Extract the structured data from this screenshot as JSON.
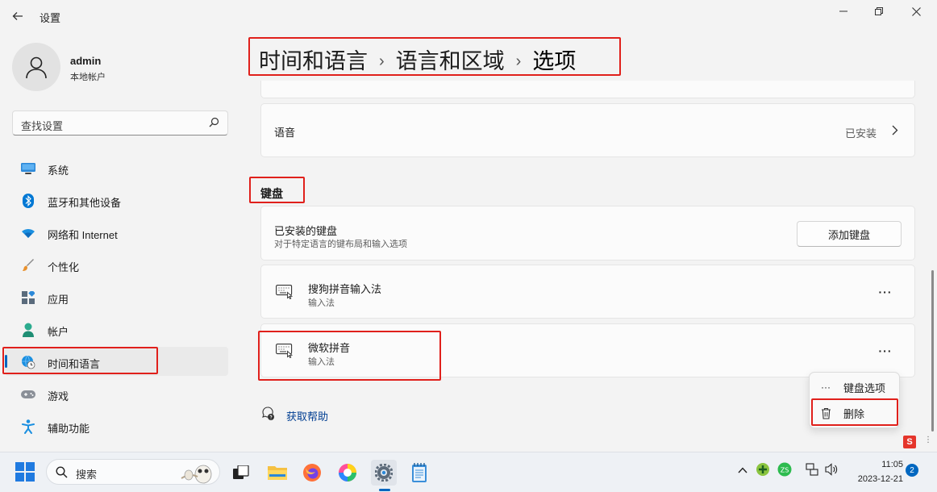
{
  "window": {
    "title": "设置",
    "controls": [
      "minimize",
      "maximize",
      "close"
    ]
  },
  "user": {
    "name": "admin",
    "account_type": "本地帐户"
  },
  "search": {
    "placeholder": "查找设置"
  },
  "sidebar": {
    "items": [
      {
        "label": "系统",
        "icon": "monitor-icon",
        "active": false
      },
      {
        "label": "蓝牙和其他设备",
        "icon": "bluetooth-icon",
        "active": false
      },
      {
        "label": "网络和 Internet",
        "icon": "wifi-icon",
        "active": false
      },
      {
        "label": "个性化",
        "icon": "brush-icon",
        "active": false
      },
      {
        "label": "应用",
        "icon": "apps-icon",
        "active": false
      },
      {
        "label": "帐户",
        "icon": "person-icon",
        "active": false
      },
      {
        "label": "时间和语言",
        "icon": "globe-clock-icon",
        "active": true
      },
      {
        "label": "游戏",
        "icon": "gamepad-icon",
        "active": false
      },
      {
        "label": "辅助功能",
        "icon": "accessibility-icon",
        "active": false
      }
    ]
  },
  "breadcrumb": {
    "items": [
      "时间和语言",
      "语言和区域",
      "选项"
    ],
    "separator": "›"
  },
  "speech": {
    "label": "语音",
    "status": "已安装"
  },
  "keyboard_section": {
    "heading": "键盘",
    "installed_title": "已安装的键盘",
    "installed_desc": "对于特定语言的键布局和输入选项",
    "add_button": "添加键盘",
    "keyboards": [
      {
        "name": "搜狗拼音输入法",
        "type": "输入法"
      },
      {
        "name": "微软拼音",
        "type": "输入法"
      }
    ]
  },
  "help": {
    "label": "获取帮助"
  },
  "context_menu": {
    "items": [
      {
        "label": "键盘选项",
        "icon": "more-icon"
      },
      {
        "label": "删除",
        "icon": "trash-icon"
      }
    ]
  },
  "taskbar": {
    "search_placeholder": "搜索",
    "time": "11:05",
    "date": "2023-12-21",
    "notification_count": "2",
    "ime_label": "S"
  },
  "colors": {
    "accent": "#0067c0",
    "annotation": "#e0201b",
    "link": "#003e92"
  }
}
